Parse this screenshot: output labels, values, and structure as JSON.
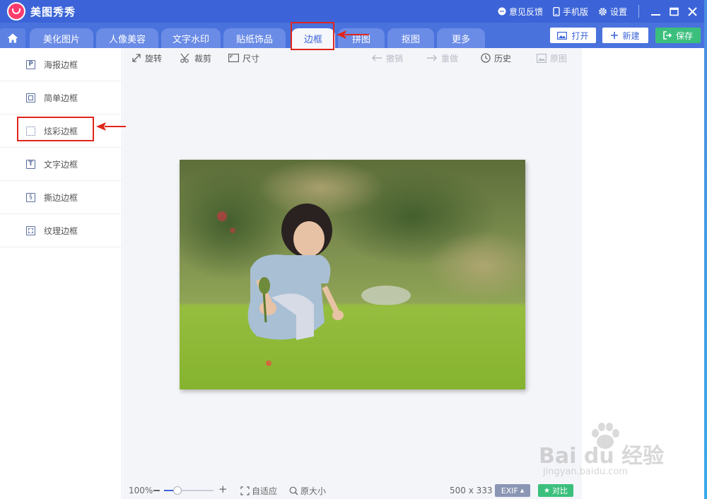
{
  "app": {
    "name": "美图秀秀"
  },
  "titlebar": {
    "feedback": "意见反馈",
    "mobile": "手机版",
    "settings": "设置"
  },
  "tabs": [
    {
      "label": "美化图片"
    },
    {
      "label": "人像美容"
    },
    {
      "label": "文字水印"
    },
    {
      "label": "贴纸饰品"
    },
    {
      "label": "边框"
    },
    {
      "label": "拼图"
    },
    {
      "label": "抠图"
    },
    {
      "label": "更多"
    }
  ],
  "actions": {
    "open": "打开",
    "new": "新建",
    "save": "保存"
  },
  "sidebar": {
    "items": [
      {
        "label": "海报边框",
        "icon": "poster-frame-icon"
      },
      {
        "label": "简单边框",
        "icon": "simple-frame-icon"
      },
      {
        "label": "炫彩边框",
        "icon": "colorful-frame-icon"
      },
      {
        "label": "文字边框",
        "icon": "text-frame-icon"
      },
      {
        "label": "撕边边框",
        "icon": "torn-frame-icon"
      },
      {
        "label": "纹理边框",
        "icon": "texture-frame-icon"
      }
    ]
  },
  "toolbar": {
    "rotate": "旋转",
    "crop": "裁剪",
    "size": "尺寸",
    "undo": "撤销",
    "redo": "重做",
    "history": "历史",
    "original": "原图"
  },
  "bottom": {
    "zoom": "100%",
    "fit": "自适应",
    "actual_size": "原大小",
    "dimensions": "500 x 333",
    "exif": "EXIF",
    "compare": "对比"
  },
  "watermark": {
    "logo": "Bai du 经验",
    "url": "jingyan.baidu.com"
  },
  "colors": {
    "primary": "#3c64d8",
    "tab_active_text": "#3c64d8",
    "save": "#3bbf7c",
    "highlight": "#e0261c"
  }
}
